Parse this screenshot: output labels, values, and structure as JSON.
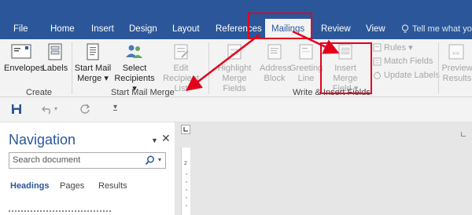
{
  "tabs": [
    {
      "label": "File"
    },
    {
      "label": "Home"
    },
    {
      "label": "Insert"
    },
    {
      "label": "Design"
    },
    {
      "label": "Layout"
    },
    {
      "label": "References"
    },
    {
      "label": "Mailings",
      "active": true
    },
    {
      "label": "Review"
    },
    {
      "label": "View"
    }
  ],
  "tell_me": "Tell me what you",
  "ribbon": {
    "create": {
      "label": "Create",
      "envelopes": "Envelopes",
      "labels": "Labels"
    },
    "start_mail_merge": {
      "label": "Start Mail Merge",
      "start_line1": "Start Mail",
      "start_line2": "Merge",
      "select_line1": "Select",
      "select_line2": "Recipients",
      "edit_line1": "Edit",
      "edit_line2": "Recipient List"
    },
    "write_insert": {
      "label": "Write & Insert Fields",
      "highlight_line1": "Highlight",
      "highlight_line2": "Merge Fields",
      "address_line1": "Address",
      "address_line2": "Block",
      "greeting_line1": "Greeting",
      "greeting_line2": "Line",
      "insert_line1": "Insert Merge",
      "insert_line2": "Field",
      "rules": "Rules",
      "match_fields": "Match Fields",
      "update_labels": "Update Labels"
    },
    "preview": {
      "line1": "Preview",
      "line2": "Results"
    }
  },
  "navigation": {
    "title": "Navigation",
    "search_placeholder": "Search document",
    "tabs": [
      "Headings",
      "Pages",
      "Results"
    ]
  },
  "colors": {
    "accent": "#2b579a",
    "ribbon_bg": "#f3f3f3",
    "annotation": "#e3001b"
  }
}
